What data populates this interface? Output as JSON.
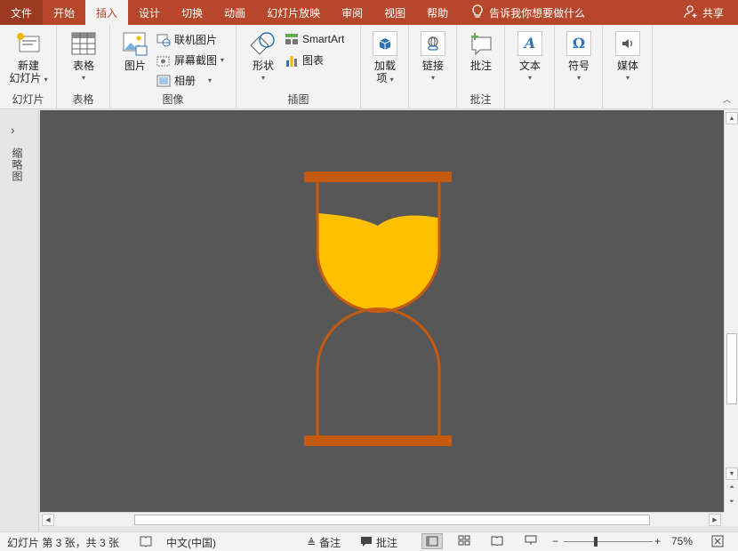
{
  "menu": {
    "tabs": [
      "文件",
      "开始",
      "插入",
      "设计",
      "切换",
      "动画",
      "幻灯片放映",
      "审阅",
      "视图",
      "帮助"
    ],
    "active_tab": "插入",
    "tell_me": "告诉我你想要做什么",
    "share": "共享"
  },
  "ribbon": {
    "slides": {
      "new_slide_line1": "新建",
      "new_slide_line2": "幻灯片",
      "label": "幻灯片"
    },
    "tables": {
      "table": "表格",
      "label": "表格"
    },
    "images": {
      "pictures": "图片",
      "online_pictures": "联机图片",
      "screenshot": "屏幕截图",
      "album": "相册",
      "label": "图像"
    },
    "illustrations": {
      "shapes": "形状",
      "smartart": "SmartArt",
      "chart": "图表",
      "label": "插图"
    },
    "addins": {
      "line1": "加载",
      "line2": "项"
    },
    "links": {
      "link": "链接"
    },
    "comments": {
      "comment": "批注",
      "label": "批注"
    },
    "text": {
      "text": "文本"
    },
    "symbols": {
      "symbols": "符号"
    },
    "media": {
      "media": "媒体"
    }
  },
  "left_pane": {
    "label": "缩略图"
  },
  "slide": {
    "colors": {
      "frame": "#c55a11",
      "sand": "#ffc000",
      "canvas": "#575757"
    }
  },
  "status": {
    "slide_info": "幻灯片 第 3 张，共 3 张",
    "language": "中文(中国)",
    "notes": "备注",
    "comments": "批注",
    "zoom": "75%",
    "zoom_level": 0.75
  }
}
